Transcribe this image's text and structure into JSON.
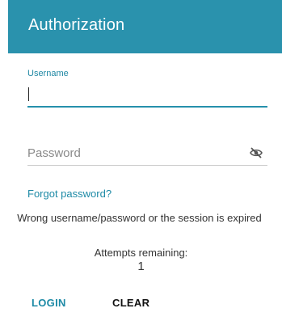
{
  "header": {
    "title": "Authorization"
  },
  "username": {
    "label": "Username",
    "value": ""
  },
  "password": {
    "placeholder": "Password",
    "visibility_icon": "eye-slash-icon"
  },
  "forgot_password": "Forgot password?",
  "message": "Wrong username/password or the session is expired",
  "attempts": {
    "label": "Attempts remaining:",
    "count": "1"
  },
  "buttons": {
    "login": "LOGIN",
    "clear": "CLEAR"
  },
  "colors": {
    "header": "#2a92ad",
    "accent": "#1d8aa6",
    "text": "#333333"
  }
}
